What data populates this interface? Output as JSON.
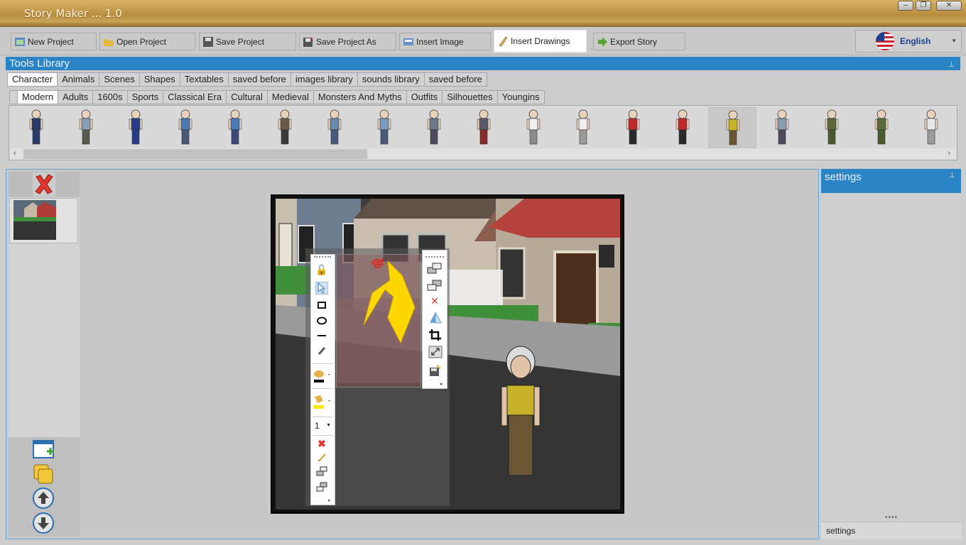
{
  "window": {
    "title": "Story Maker ... 1.0"
  },
  "toolbar": {
    "buttons": [
      {
        "label": "New Project"
      },
      {
        "label": "Open Project"
      },
      {
        "label": "Save Project"
      },
      {
        "label": "Save Project As"
      },
      {
        "label": "Insert Image"
      },
      {
        "label": "Insert Drawings"
      },
      {
        "label": "Export Story"
      }
    ],
    "language": "English"
  },
  "library": {
    "title": "Tools Library",
    "tabs": [
      "Character",
      "Animals",
      "Scenes",
      "Shapes",
      "Textables",
      "saved before",
      "images library",
      "sounds library",
      "saved before"
    ],
    "subtabs": [
      "Modern",
      "Adults",
      "1600s",
      "Sports",
      "Classical Era",
      "Cultural",
      "Medieval",
      "Monsters And Myths",
      "Outfits",
      "Silhouettes",
      "Youngins"
    ]
  },
  "drawing": {
    "line_width": "1"
  },
  "settings": {
    "title": "settings",
    "footer": "settings"
  },
  "colors": {
    "accent": "#2b84c6",
    "toolbar": "#c9c9c9",
    "drawing_shape": "#ffd700"
  }
}
